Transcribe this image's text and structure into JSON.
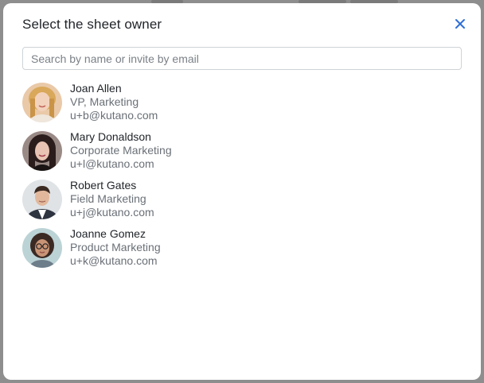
{
  "dialog": {
    "title": "Select the sheet owner",
    "close_icon": "close-icon",
    "accent_color": "#2f6fd6"
  },
  "search": {
    "placeholder": "Search by name or invite by email",
    "value": ""
  },
  "users": [
    {
      "name": "Joan Allen",
      "title": "VP, Marketing",
      "email": "u+b@kutano.com",
      "avatar": "avatar-photo"
    },
    {
      "name": "Mary Donaldson",
      "title": "Corporate Marketing",
      "email": "u+l@kutano.com",
      "avatar": "avatar-photo"
    },
    {
      "name": "Robert Gates",
      "title": "Field Marketing",
      "email": "u+j@kutano.com",
      "avatar": "avatar-photo"
    },
    {
      "name": "Joanne Gomez",
      "title": "Product Marketing",
      "email": "u+k@kutano.com",
      "avatar": "avatar-photo"
    }
  ]
}
